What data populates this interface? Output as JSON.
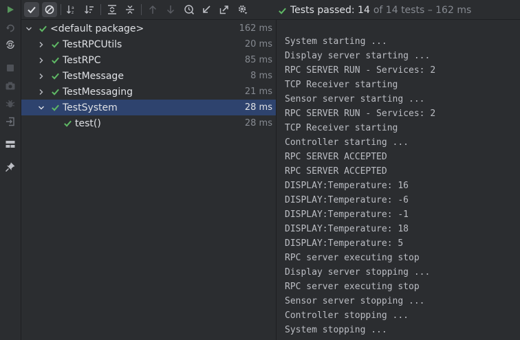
{
  "toolbar": {
    "buttons": [
      {
        "name": "rerun-button",
        "icon": "play-icon"
      },
      {
        "name": "show-passed-toggle",
        "icon": "check-icon"
      },
      {
        "name": "show-ignored-toggle",
        "icon": "cancel-circle-icon"
      },
      {
        "name": "sort-alphabetically-button",
        "icon": "sort-alpha-icon"
      },
      {
        "name": "sort-by-duration-button",
        "icon": "sort-duration-icon"
      },
      {
        "name": "expand-all-button",
        "icon": "expand-all-icon"
      },
      {
        "name": "collapse-all-button",
        "icon": "collapse-all-icon"
      },
      {
        "name": "previous-failed-button",
        "icon": "arrow-up-icon"
      },
      {
        "name": "next-failed-button",
        "icon": "arrow-down-icon"
      },
      {
        "name": "test-history-button",
        "icon": "history-icon"
      },
      {
        "name": "import-tests-button",
        "icon": "import-icon"
      },
      {
        "name": "export-tests-button",
        "icon": "export-icon"
      },
      {
        "name": "settings-button",
        "icon": "gear-icon"
      }
    ],
    "status": {
      "main": "Tests passed: 14",
      "detail": "of 14 tests – 162 ms"
    }
  },
  "left_strip": [
    {
      "name": "rerun-failed-button",
      "icon": "rerun-icon"
    },
    {
      "name": "toggle-auto-test-button",
      "icon": "auto-test-icon"
    },
    {
      "name": "stop-button",
      "icon": "stop-icon"
    },
    {
      "name": "screenshot-button",
      "icon": "camera-icon"
    },
    {
      "name": "debug-button",
      "icon": "bug-icon"
    },
    {
      "name": "exit-button",
      "icon": "exit-icon"
    },
    {
      "name": "layout-button",
      "icon": "layout-icon"
    },
    {
      "name": "pin-tab-button",
      "icon": "pin-icon"
    }
  ],
  "tree": {
    "rows": [
      {
        "label": "<default package>",
        "time": "162 ms",
        "level": 0,
        "expanded": true
      },
      {
        "label": "TestRPCUtils",
        "time": "20 ms",
        "level": 1,
        "expanded": false
      },
      {
        "label": "TestRPC",
        "time": "85 ms",
        "level": 1,
        "expanded": false
      },
      {
        "label": "TestMessage",
        "time": "8 ms",
        "level": 1,
        "expanded": false
      },
      {
        "label": "TestMessaging",
        "time": "21 ms",
        "level": 1,
        "expanded": false
      },
      {
        "label": "TestSystem",
        "time": "28 ms",
        "level": 1,
        "expanded": true,
        "selected": true
      },
      {
        "label": "test()",
        "time": "28 ms",
        "level": 2,
        "leaf": true
      }
    ]
  },
  "console": {
    "lines": [
      "System starting ...",
      "Display server starting ...",
      "RPC SERVER RUN - Services: 2",
      "TCP Receiver starting",
      "Sensor server starting ...",
      "RPC SERVER RUN - Services: 2",
      "TCP Receiver starting",
      "Controller starting ...",
      "RPC SERVER ACCEPTED",
      "RPC SERVER ACCEPTED",
      "DISPLAY:Temperature: 16",
      "DISPLAY:Temperature: -6",
      "DISPLAY:Temperature: -1",
      "DISPLAY:Temperature: 18",
      "DISPLAY:Temperature: 5",
      "RPC server executing stop",
      "Display server stopping ...",
      "RPC server executing stop",
      "Sensor server stopping ...",
      "Controller stopping ...",
      "System stopping ..."
    ]
  },
  "colors": {
    "pass": "#5fb865",
    "play": "#57965c",
    "selection": "#2e436e"
  }
}
